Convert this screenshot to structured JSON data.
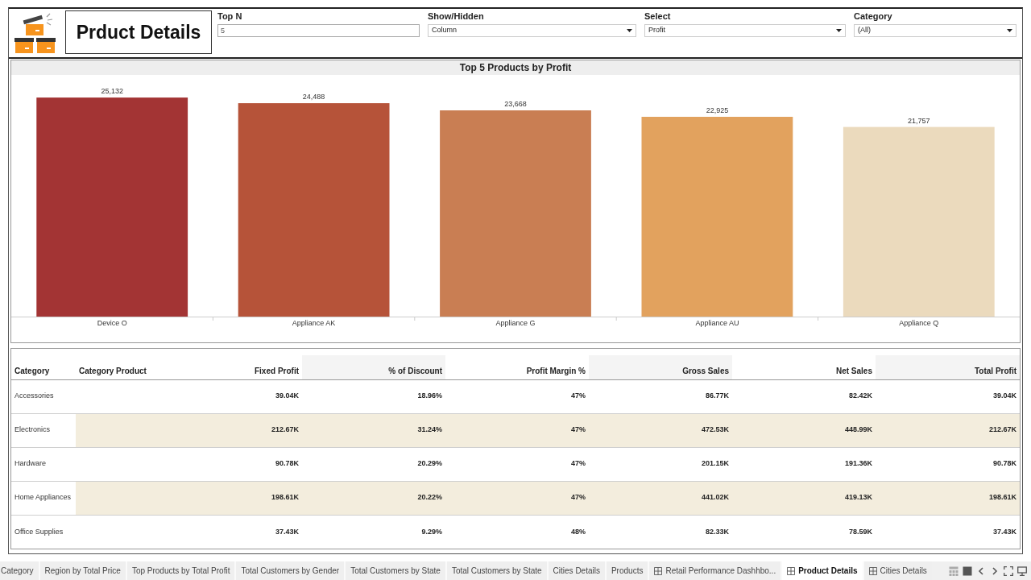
{
  "header": {
    "title": "Prduct Details",
    "filters": [
      {
        "label": "Top N",
        "kind": "text",
        "value": "5"
      },
      {
        "label": "Show/Hidden",
        "kind": "dropdown",
        "value": "Column"
      },
      {
        "label": "Select",
        "kind": "dropdown",
        "value": "Profit"
      },
      {
        "label": "Category",
        "kind": "dropdown",
        "value": "(All)"
      }
    ]
  },
  "chart": {
    "chart_data": {
      "type": "bar",
      "title": "Top 5 Products by Profit",
      "categories": [
        "Device O",
        "Appliance AK",
        "Appliance G",
        "Appliance AU",
        "Appliance Q"
      ],
      "series": [
        {
          "values": [
            25132,
            24488,
            23668,
            22925,
            21757
          ],
          "value_labels": [
            "25,132",
            "24,488",
            "23,668",
            "22,925",
            "21,757"
          ],
          "colors": [
            "#a33434",
            "#b65339",
            "#c97e53",
            "#e2a25e",
            "#ebdabd"
          ]
        }
      ]
    }
  },
  "table": {
    "columns": [
      "Category",
      "Category Product",
      "Fixed Profit",
      "% of Discount",
      "Profit Margin %",
      "Gross Sales",
      "Net Sales",
      "Total Profit"
    ],
    "rows": [
      {
        "category": "Accessories",
        "values": [
          "39.04K",
          "18.96%",
          "47%",
          "86.77K",
          "82.42K",
          "39.04K"
        ]
      },
      {
        "category": "Electronics",
        "values": [
          "212.67K",
          "31.24%",
          "47%",
          "472.53K",
          "448.99K",
          "212.67K"
        ]
      },
      {
        "category": "Hardware",
        "values": [
          "90.78K",
          "20.29%",
          "47%",
          "201.15K",
          "191.36K",
          "90.78K"
        ]
      },
      {
        "category": "Home Appliances",
        "values": [
          "198.61K",
          "20.22%",
          "47%",
          "441.02K",
          "419.13K",
          "198.61K"
        ]
      },
      {
        "category": "Office Supplies",
        "values": [
          "37.43K",
          "9.29%",
          "48%",
          "82.33K",
          "78.59K",
          "37.43K"
        ]
      }
    ]
  },
  "sheet_tabs": [
    {
      "label": "Category",
      "kind": "sheet",
      "selected": false
    },
    {
      "label": "Region by Total Price",
      "kind": "sheet",
      "selected": false
    },
    {
      "label": "Top Products by Total Profit",
      "kind": "sheet",
      "selected": false
    },
    {
      "label": "Total Customers by Gender",
      "kind": "sheet",
      "selected": false
    },
    {
      "label": "Total Customers by State",
      "kind": "sheet",
      "selected": false
    },
    {
      "label": "Total Customers by State",
      "kind": "sheet",
      "selected": false
    },
    {
      "label": "Cities Details",
      "kind": "sheet",
      "selected": false
    },
    {
      "label": "Products",
      "kind": "sheet",
      "selected": false
    },
    {
      "label": "Retail Performance Dashhbo...",
      "kind": "dashboard",
      "selected": false
    },
    {
      "label": "Product Details",
      "kind": "dashboard",
      "selected": true
    },
    {
      "label": "Cities Details",
      "kind": "dashboard",
      "selected": false
    }
  ]
}
